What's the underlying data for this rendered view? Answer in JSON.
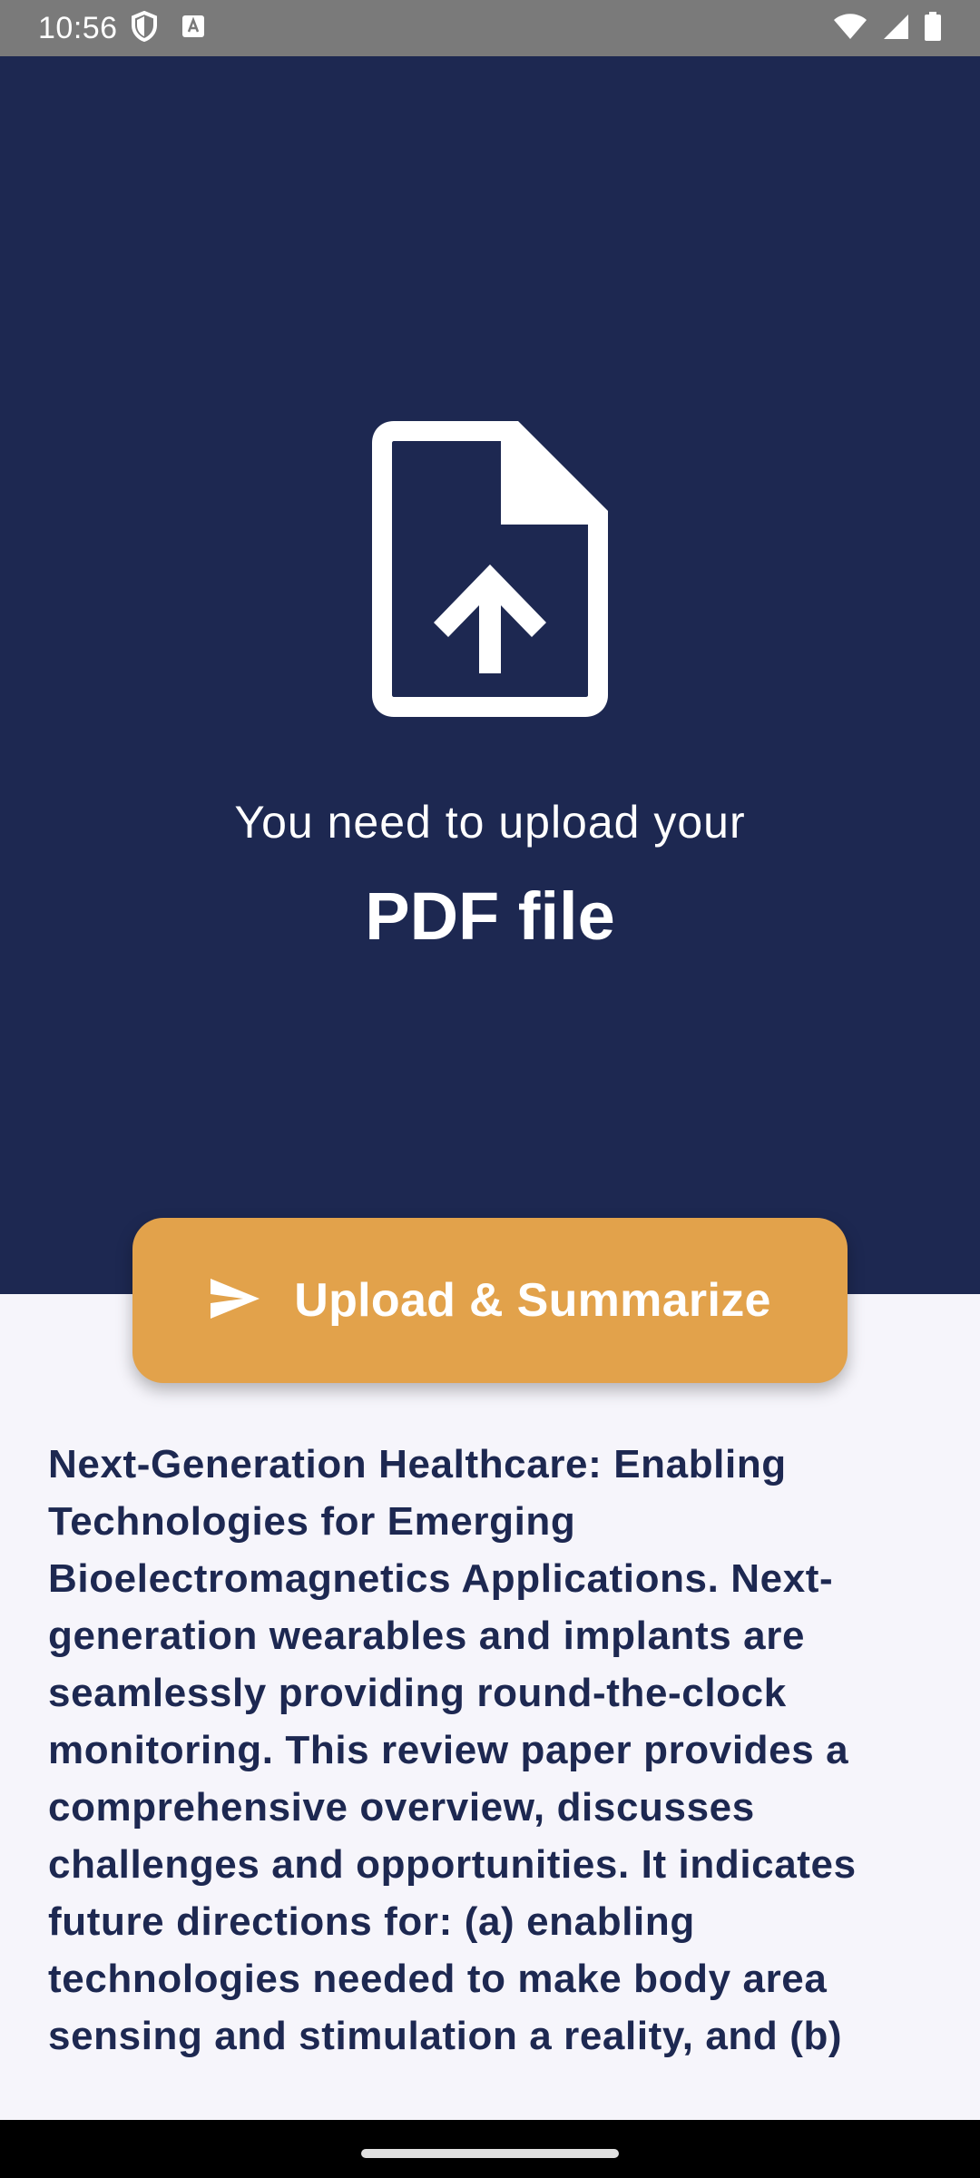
{
  "status_bar": {
    "time": "10:56",
    "left_icons": [
      "shield-icon",
      "keyboard-a-icon"
    ],
    "right_icons": [
      "wifi-icon",
      "cellular-signal-icon",
      "battery-icon"
    ]
  },
  "hero": {
    "icon": "file-upload-icon",
    "subtitle": "You need to upload your",
    "title": "PDF file"
  },
  "upload_button": {
    "icon": "send-icon",
    "label": "Upload & Summarize"
  },
  "summary": {
    "text": "Next-Generation Healthcare: Enabling Technologies for Emerging Bioelectromagnetics Applications. Next-generation wearables and implants are seamlessly providing round-the-clock monitoring. This review paper provides a comprehensive overview, discusses challenges and opportunities. It indicates future directions for: (a) enabling technologies needed to make body area sensing and stimulation a reality, and (b)"
  },
  "colors": {
    "hero_background": "#1D2851",
    "accent": "#E2A24B",
    "page_background": "#F6F5FB",
    "text": "#1D2851"
  }
}
